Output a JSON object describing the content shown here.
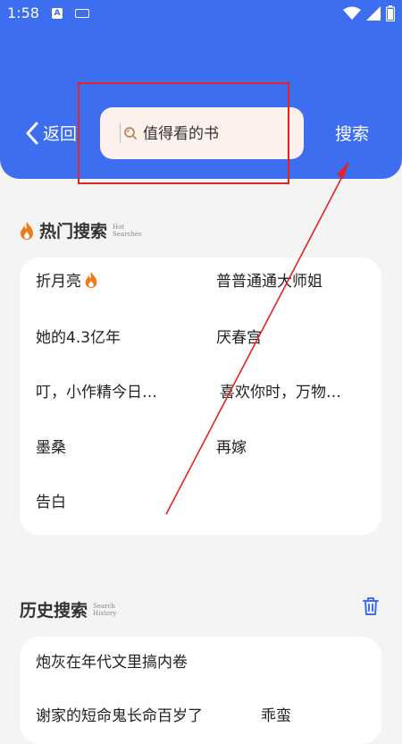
{
  "status_bar": {
    "time": "1:58",
    "a_icon": "A"
  },
  "header": {
    "back_label": "返回",
    "search_placeholder": "值得看的书",
    "search_button": "搜索"
  },
  "hot": {
    "title": "热门搜索",
    "subtitle_line1": "Hot",
    "subtitle_line2": "Searches",
    "items": [
      "折月亮",
      "普普通通大师姐",
      "她的4.3亿年",
      "厌春宫",
      "叮，小作精今日…",
      "喜欢你时，万物…",
      "墨桑",
      "再嫁",
      "告白"
    ]
  },
  "history": {
    "title": "历史搜索",
    "subtitle_line1": "Search",
    "subtitle_line2": "History",
    "items": [
      "炮灰在年代文里搞内卷",
      "谢家的短命鬼长命百岁了",
      "乖蛮"
    ]
  },
  "colors": {
    "header_blue": "#3d6ef0",
    "highlight_red": "#e52321",
    "fire_orange": "#f07a1a",
    "trash_blue": "#3d6ef0"
  },
  "icons": [
    "back-chevron-icon",
    "search-icon",
    "fire-icon",
    "trash-icon",
    "wifi-icon",
    "signal-icon",
    "battery-icon",
    "keyboard-icon"
  ]
}
